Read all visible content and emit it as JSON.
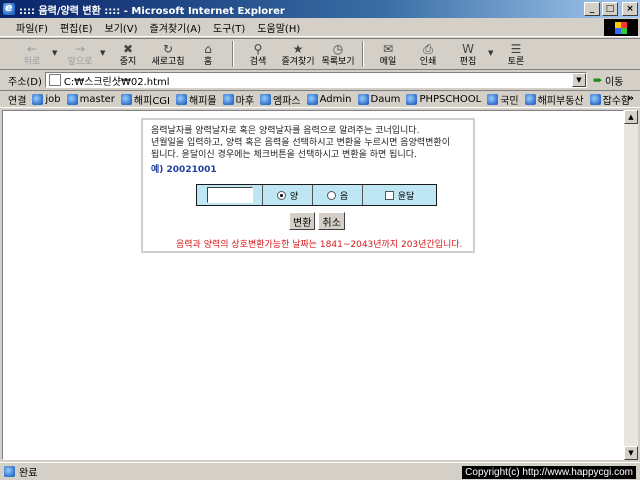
{
  "window": {
    "title": ":::: 음력/양력 변환 :::: - Microsoft Internet Explorer",
    "min": "_",
    "max": "□",
    "close": "×"
  },
  "menu": [
    "파일(F)",
    "편집(E)",
    "보기(V)",
    "즐겨찾기(A)",
    "도구(T)",
    "도움말(H)"
  ],
  "toolbar": {
    "back": "뒤로",
    "forward": "앞으로",
    "stop": "중지",
    "refresh": "새로고침",
    "home": "홈",
    "search": "검색",
    "favorites": "즐겨찾기",
    "history": "목록보기",
    "mail": "메일",
    "print": "인쇄",
    "edit": "편집",
    "discuss": "토론"
  },
  "address": {
    "label": "주소(D)",
    "value": "C:₩스크린샷₩02.html",
    "go": "이동"
  },
  "links": {
    "label": "연결",
    "items": [
      "job",
      "master",
      "해피CGI",
      "해피몰",
      "마후",
      "엠파스",
      "Admin",
      "Daum",
      "PHPSCHOOL",
      "국민",
      "해피부동산",
      "잡수함"
    ],
    "more": "»"
  },
  "content": {
    "intro": "음력날자를 양력날자로 혹은 양력날자를 음력으로 알려주는 코너입니다.\n년월일을 입력하고, 양력 혹은 음력을 선택하시고 변환을 누르시면 음양력변환이\n됩니다. 윤달이신 경우에는 체크버튼을 선택하시고 변환을 하면 됩니다.",
    "example": "예) 20021001",
    "date_value": "",
    "radio_solar": "양",
    "radio_lunar": "음",
    "leap": "윤달",
    "convert": "변환",
    "cancel": "취소",
    "notice": "음력과 양력의 상호변환가능한 날짜는 1841~2043년까지 203년간입니다."
  },
  "status": {
    "text": "완료",
    "copyright": "Copyright(c) http://www.happycgi.com"
  }
}
